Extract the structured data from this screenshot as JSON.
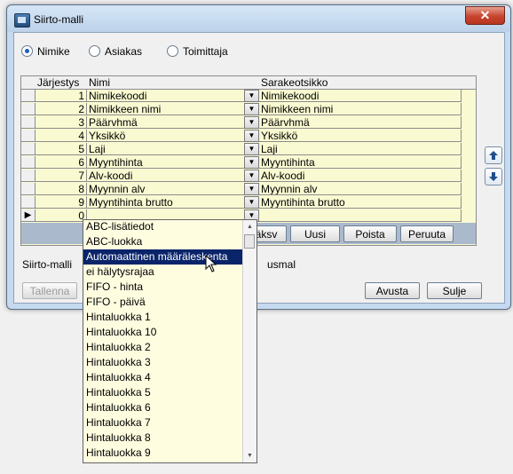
{
  "window": {
    "title": "Siirto-malli",
    "close_glyph": "✕"
  },
  "radios": [
    {
      "label": "Nimike",
      "checked": true
    },
    {
      "label": "Asiakas",
      "checked": false
    },
    {
      "label": "Toimittaja",
      "checked": false
    }
  ],
  "grid": {
    "headers": {
      "order": "Järjestys",
      "name": "Nimi",
      "column_title": "Sarakeotsikko"
    },
    "rows": [
      {
        "order": "1",
        "name": "Nimikekoodi",
        "column_title": "Nimikekoodi"
      },
      {
        "order": "2",
        "name": "Nimikkeen nimi",
        "column_title": "Nimikkeen nimi"
      },
      {
        "order": "3",
        "name": "Päärvhmä",
        "column_title": "Päärvhmä"
      },
      {
        "order": "4",
        "name": "Yksikkö",
        "column_title": "Yksikkö"
      },
      {
        "order": "5",
        "name": "Laji",
        "column_title": "Laji"
      },
      {
        "order": "6",
        "name": "Myyntihinta",
        "column_title": "Myyntihinta"
      },
      {
        "order": "7",
        "name": "Alv-koodi",
        "column_title": "Alv-koodi"
      },
      {
        "order": "8",
        "name": "Myynnin alv",
        "column_title": "Myynnin alv"
      },
      {
        "order": "9",
        "name": "Myyntihinta brutto",
        "column_title": "Myyntihinta brutto"
      },
      {
        "order": "0",
        "name": "",
        "column_title": ""
      }
    ],
    "current_row_indicator": "▶",
    "bar_buttons": {
      "new_partial": "äksv",
      "new": "Uusi",
      "delete": "Poista",
      "cancel": "Peruuta"
    }
  },
  "footer": {
    "label": "Siirto-malli",
    "label_partial": "usmal",
    "save": "Tallenna",
    "help": "Avusta",
    "close": "Sulje"
  },
  "dropdown": {
    "items": [
      "ABC-lisätiedot",
      "ABC-luokka",
      "Automaattinen määräleskenta",
      "ei hälytysrajaa",
      "FIFO - hinta",
      "FIFO - päivä",
      "Hintaluokka 1",
      "Hintaluokka 10",
      "Hintaluokka 2",
      "Hintaluokka 3",
      "Hintaluokka 4",
      "Hintaluokka 5",
      "Hintaluokka 6",
      "Hintaluokka 7",
      "Hintaluokka 8",
      "Hintaluokka 9"
    ],
    "selected_index": 2
  },
  "icons": {
    "move_up": "arrow-up-icon",
    "move_down": "arrow-down-icon",
    "row_dropdown": "dropdown-arrow-icon",
    "cursor": "mouse-pointer-icon"
  }
}
